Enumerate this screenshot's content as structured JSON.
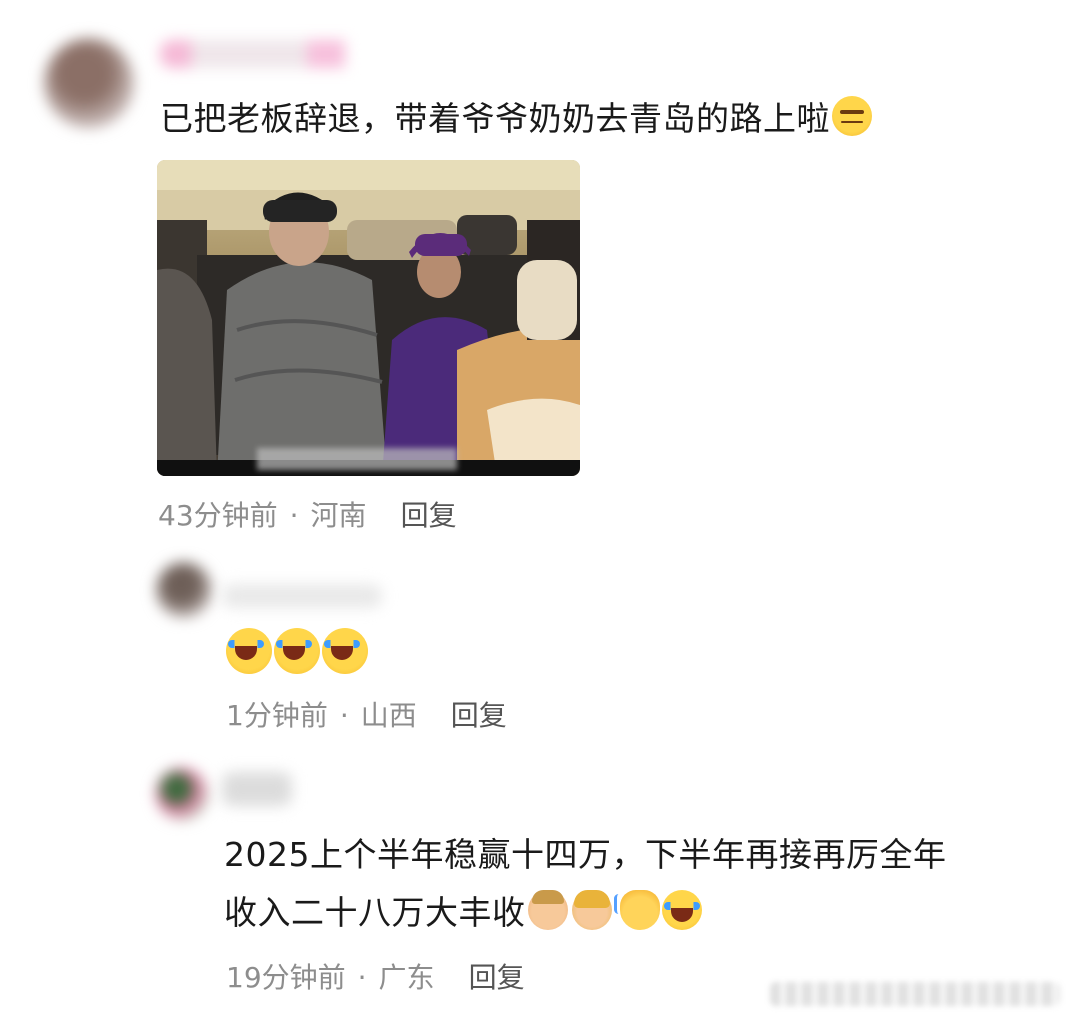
{
  "comments": [
    {
      "text": "已把老板辞退，带着爷爷奶奶去青岛的路上啦",
      "emojis": [
        "thinking-face"
      ],
      "time": "43分钟前",
      "separator": "·",
      "location": "河南",
      "reply": "回复"
    },
    {
      "text": "",
      "emojis": [
        "laughing-crying-face",
        "laughing-crying-face",
        "laughing-crying-face"
      ],
      "time": "1分钟前",
      "separator": "·",
      "location": "山西",
      "reply": "回复"
    },
    {
      "text_line1": "2025上个半年稳赢十四万，下半年再接再厉全年",
      "text_line2": "收入二十八万大丰收",
      "emojis": [
        "man-face",
        "woman-face",
        "waving-hand",
        "laughing-crying-face"
      ],
      "time": "19分钟前",
      "separator": "·",
      "location": "广东",
      "reply": "回复"
    }
  ]
}
